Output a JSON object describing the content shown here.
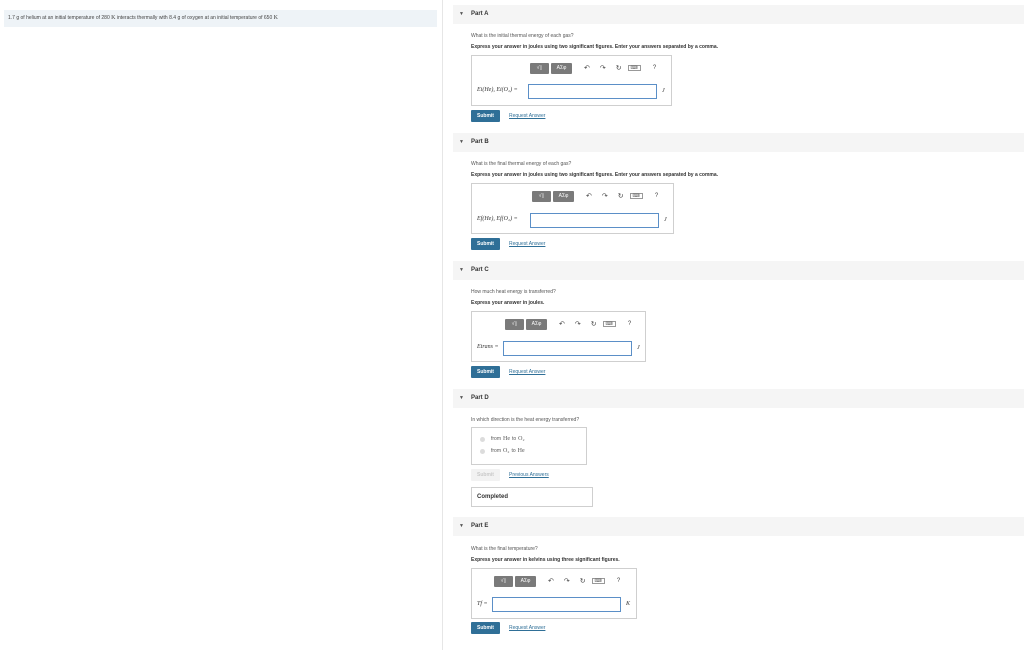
{
  "problem": {
    "text_a": "1.7 g of helium at an initial temperature of 280",
    "unit_a": "K",
    "text_b": "interacts thermally with 8.4 g of oxygen at an initial temperature of 650",
    "unit_b": "K"
  },
  "toolbar": {
    "template_btn": "√▯",
    "greek_btn": "ΑΣφ",
    "undo_icon": "↶",
    "redo_icon": "↷",
    "reset_icon": "↻",
    "keyboard_icon": "⌨",
    "help_icon": "?"
  },
  "parts": [
    {
      "label": "Part A",
      "question": "What is the initial thermal energy of each gas?",
      "instruction": "Express your answer in joules using two significant figures. Enter your answers separated by a comma.",
      "answer_label": "Ei(He), Ei(O₂) =",
      "unit": "J",
      "submit": "Submit",
      "link": "Request Answer"
    },
    {
      "label": "Part B",
      "question": "What is the final thermal energy of each gas?",
      "instruction": "Express your answer in joules using two significant figures. Enter your answers separated by a comma.",
      "answer_label": "Ef(He), Ef(O₂) =",
      "unit": "J",
      "submit": "Submit",
      "link": "Request Answer"
    },
    {
      "label": "Part C",
      "question": "How much heat energy is transferred?",
      "instruction": "Express your answer in joules.",
      "answer_label": "Etrans =",
      "unit": "J",
      "submit": "Submit",
      "link": "Request Answer"
    },
    {
      "label": "Part D",
      "question": "In which direction is the heat energy transferred?",
      "options": [
        {
          "prefix": "from",
          "from": "He",
          "to_word": "to",
          "to": "O₂"
        },
        {
          "prefix": "from",
          "from": "O₂",
          "to_word": "to",
          "to": "He"
        }
      ],
      "submit": "Submit",
      "link": "Previous Answers",
      "status": "Completed"
    },
    {
      "label": "Part E",
      "question": "What is the final temperature?",
      "instruction": "Express your answer in kelvins using three significant figures.",
      "answer_label": "Tf =",
      "unit": "K",
      "submit": "Submit",
      "link": "Request Answer"
    }
  ]
}
